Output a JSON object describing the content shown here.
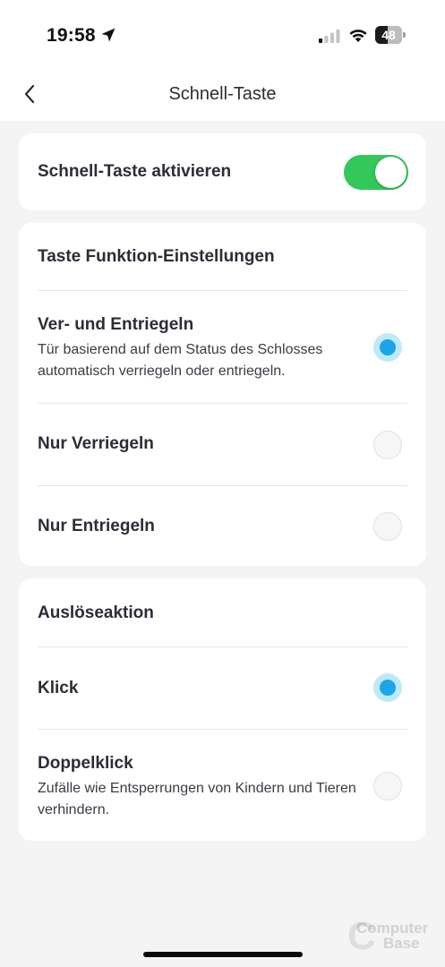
{
  "status_bar": {
    "time": "19:58",
    "battery_level": "48",
    "battery_percent": 48,
    "icons": [
      "location-arrow-icon",
      "cellular-signal-icon",
      "wifi-icon",
      "battery-icon"
    ]
  },
  "nav": {
    "title": "Schnell-Taste",
    "back_icon": "chevron-left-icon"
  },
  "activate_card": {
    "label": "Schnell-Taste aktivieren",
    "enabled": true
  },
  "function_card": {
    "heading": "Taste Funktion-Einstellungen",
    "options": [
      {
        "title": "Ver- und Entriegeln",
        "description": "Tür basierend auf dem Status des Schlosses automatisch verriegeln oder entriegeln.",
        "selected": true
      },
      {
        "title": "Nur Verriegeln",
        "selected": false
      },
      {
        "title": "Nur Entriegeln",
        "selected": false
      }
    ]
  },
  "trigger_card": {
    "heading": "Auslöseaktion",
    "options": [
      {
        "title": "Klick",
        "selected": true
      },
      {
        "title": "Doppelklick",
        "description": "Zufälle wie Entsperrungen von Kindern und Tieren verhindern.",
        "selected": false
      }
    ]
  },
  "watermark": {
    "line1": "Computer",
    "line2": "Base"
  },
  "colors": {
    "toggle_on": "#34c759",
    "radio_selected": "#1aa6e8",
    "radio_selected_halo": "#bfe9f9",
    "background": "#f4f4f5",
    "card": "#ffffff",
    "text": "#2b2d36"
  }
}
